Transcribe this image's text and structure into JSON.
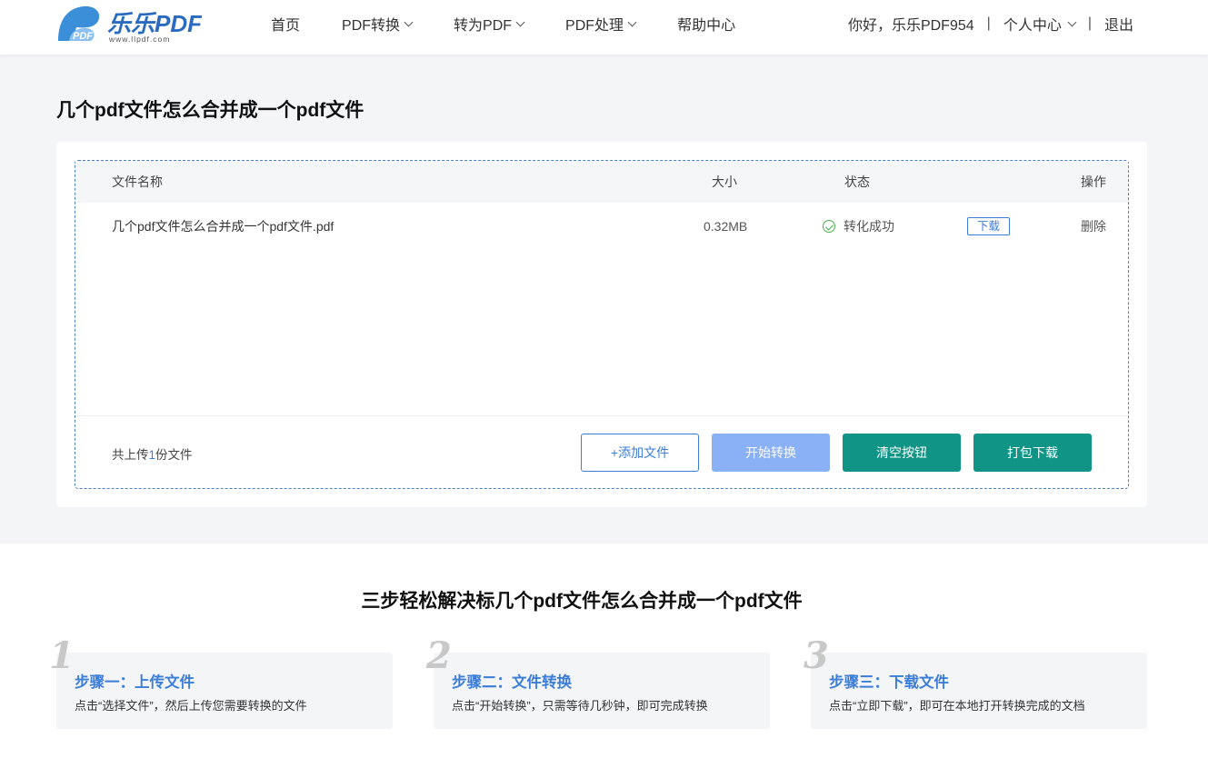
{
  "brand": {
    "name": "乐乐PDF",
    "tagline": "www.llpdf.com",
    "logo_mark": "PDF",
    "primary_color": "#3b7dd8",
    "accent_color": "#0f9486"
  },
  "nav": {
    "items": [
      {
        "label": "首页",
        "dropdown": false
      },
      {
        "label": "PDF转换",
        "dropdown": true
      },
      {
        "label": "转为PDF",
        "dropdown": true
      },
      {
        "label": "PDF处理",
        "dropdown": true
      },
      {
        "label": "帮助中心",
        "dropdown": false
      }
    ]
  },
  "user": {
    "greeting": "你好，乐乐PDF954",
    "separator": "|",
    "center_label": "个人中心",
    "logout_label": "退出"
  },
  "page": {
    "title": "几个pdf文件怎么合并成一个pdf文件"
  },
  "table": {
    "headers": {
      "name": "文件名称",
      "size": "大小",
      "status": "状态",
      "op": "操作"
    },
    "rows": [
      {
        "name": "几个pdf文件怎么合并成一个pdf文件.pdf",
        "size": "0.32MB",
        "status": "转化成功",
        "download": "下载",
        "delete": "删除"
      }
    ]
  },
  "footer_bar": {
    "count_prefix": "共上传",
    "count": "1",
    "count_suffix": "份文件",
    "add_label": "+添加文件",
    "start_label": "开始转换",
    "clear_label": "清空按钮",
    "pack_label": "打包下载"
  },
  "steps": {
    "title": "三步轻松解决标几个pdf文件怎么合并成一个pdf文件",
    "items": [
      {
        "num": "1",
        "title": "步骤一：上传文件",
        "desc": "点击“选择文件”，然后上传您需要转换的文件"
      },
      {
        "num": "2",
        "title": "步骤二：文件转换",
        "desc": "点击“开始转换”，只需等待几秒钟，即可完成转换"
      },
      {
        "num": "3",
        "title": "步骤三：下载文件",
        "desc": "点击“立即下载”，即可在本地打开转换完成的文档"
      }
    ]
  }
}
